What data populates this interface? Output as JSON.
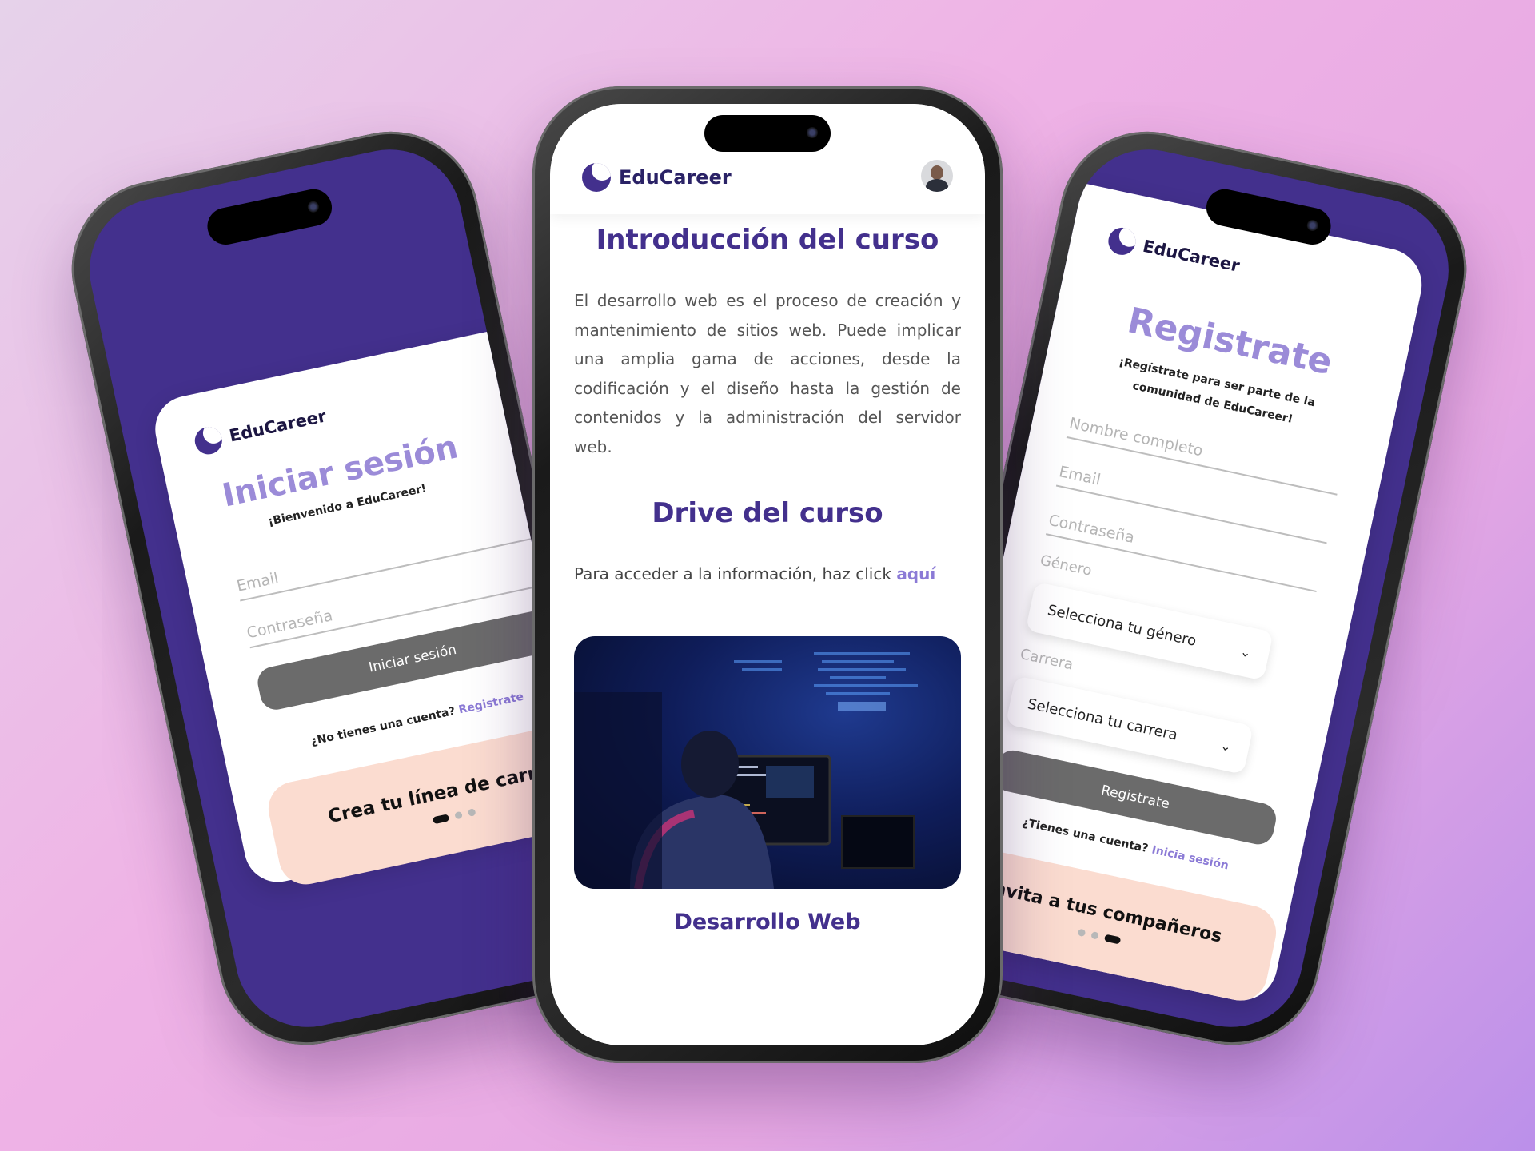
{
  "brand": {
    "name": "EduCareer",
    "colors": {
      "primary": "#43308d",
      "accent_light": "#9b8bd8",
      "promo": "#fbdcd0",
      "button": "#6b6b6b"
    }
  },
  "login_screen": {
    "title": "Iniciar sesión",
    "subtitle": "¡Bienvenido a EduCareer!",
    "email_placeholder": "Email",
    "password_placeholder": "Contraseña",
    "submit_label": "Iniciar sesión",
    "no_account_text": "¿No tienes una cuenta?",
    "register_link": "Registrate",
    "promo_text": "Crea tu línea de carrera",
    "carousel_active_index": 0
  },
  "course_screen": {
    "avatar_icon": "user-avatar",
    "intro_title": "Introducción del curso",
    "intro_text": "El desarrollo web es el proceso de creación y mantenimiento de sitios web. Puede implicar una amplia gama de acciones, desde la codificación y el diseño hasta la gestión de contenidos y la administración del servidor web.",
    "drive_title": "Drive del curso",
    "drive_text": "Para acceder a la información, haz click",
    "drive_link": "aquí",
    "course_name": "Desarrollo Web"
  },
  "register_screen": {
    "title": "Registrate",
    "subtitle": "¡Regístrate para ser parte de la comunidad de EduCareer!",
    "name_placeholder": "Nombre completo",
    "email_placeholder": "Email",
    "password_placeholder": "Contraseña",
    "gender_label": "Género",
    "gender_select": "Selecciona tu género",
    "career_label": "Carrera",
    "career_select": "Selecciona tu carrera",
    "submit_label": "Registrate",
    "have_account_text": "¿Tienes una cuenta?",
    "login_link": "Inicia sesión",
    "promo_text": "Invita a tus compañeros",
    "carousel_active_index": 2
  }
}
